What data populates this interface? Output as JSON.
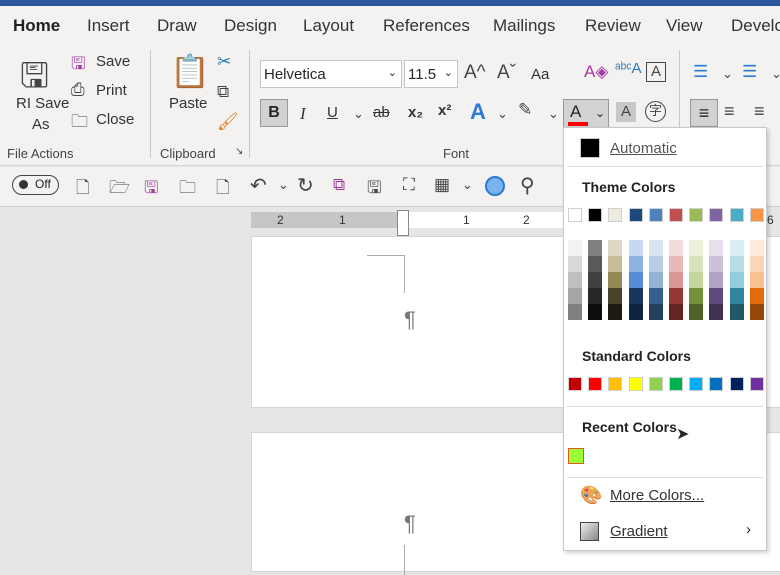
{
  "tabs": [
    "Home",
    "Insert",
    "Draw",
    "Design",
    "Layout",
    "References",
    "Mailings",
    "Review",
    "View",
    "Develo"
  ],
  "file_actions": {
    "save_as": "RI Save",
    "save_as2": "As",
    "save": "Save",
    "print": "Print",
    "close": "Close",
    "group": "File Actions"
  },
  "clipboard": {
    "paste": "Paste",
    "group": "Clipboard"
  },
  "font": {
    "name": "Helvetica",
    "size": "11.5",
    "group": "Font",
    "case": "Aa",
    "bold": "B",
    "italic": "I",
    "underline": "U",
    "strike": "ab",
    "sub": "x₂",
    "sup": "x²",
    "color_bar": "#ff0000"
  },
  "qat": {
    "toggle": "Off"
  },
  "ruler": {
    "labels": [
      "2",
      "1",
      "1",
      "2",
      "6"
    ]
  },
  "page": {
    "pilcrow": "¶"
  },
  "dropdown": {
    "automatic": "Automatic",
    "theme_title": "Theme Colors",
    "theme": [
      "#ffffff",
      "#000000",
      "#eeece1",
      "#1f497d",
      "#4f81bd",
      "#c0504d",
      "#9bbb59",
      "#8064a2",
      "#4bacc6",
      "#f79646"
    ],
    "shades": [
      [
        "#f2f2f2",
        "#d9d9d9",
        "#bfbfbf",
        "#a6a6a6",
        "#808080"
      ],
      [
        "#808080",
        "#595959",
        "#404040",
        "#262626",
        "#0d0d0d"
      ],
      [
        "#ddd9c4",
        "#c4bd97",
        "#948a54",
        "#4a452a",
        "#1d1b10"
      ],
      [
        "#c6d9f1",
        "#8db3e2",
        "#548dd4",
        "#17375e",
        "#0f243e"
      ],
      [
        "#dbe5f1",
        "#b8cce4",
        "#95b3d7",
        "#366092",
        "#244061"
      ],
      [
        "#f2dcdb",
        "#e6b9b8",
        "#d99694",
        "#953734",
        "#632423"
      ],
      [
        "#ebf1dd",
        "#d7e3bc",
        "#c3d69b",
        "#76923c",
        "#4f6128"
      ],
      [
        "#e5e0ec",
        "#ccc1d9",
        "#b2a2c7",
        "#5f497a",
        "#3f3151"
      ],
      [
        "#dbeef3",
        "#b7dde8",
        "#92cddc",
        "#31859b",
        "#205867"
      ],
      [
        "#fdeada",
        "#fbd5b5",
        "#fac08f",
        "#e36c09",
        "#974806"
      ]
    ],
    "standard_title": "Standard Colors",
    "standard": [
      "#c00000",
      "#ff0000",
      "#ffc000",
      "#ffff00",
      "#92d050",
      "#00b050",
      "#00b0f0",
      "#0070c0",
      "#002060",
      "#7030a0"
    ],
    "recent_title": "Recent Colors",
    "recent": [
      "#99ff33"
    ],
    "more": "More Colors...",
    "gradient": "Gradient"
  }
}
